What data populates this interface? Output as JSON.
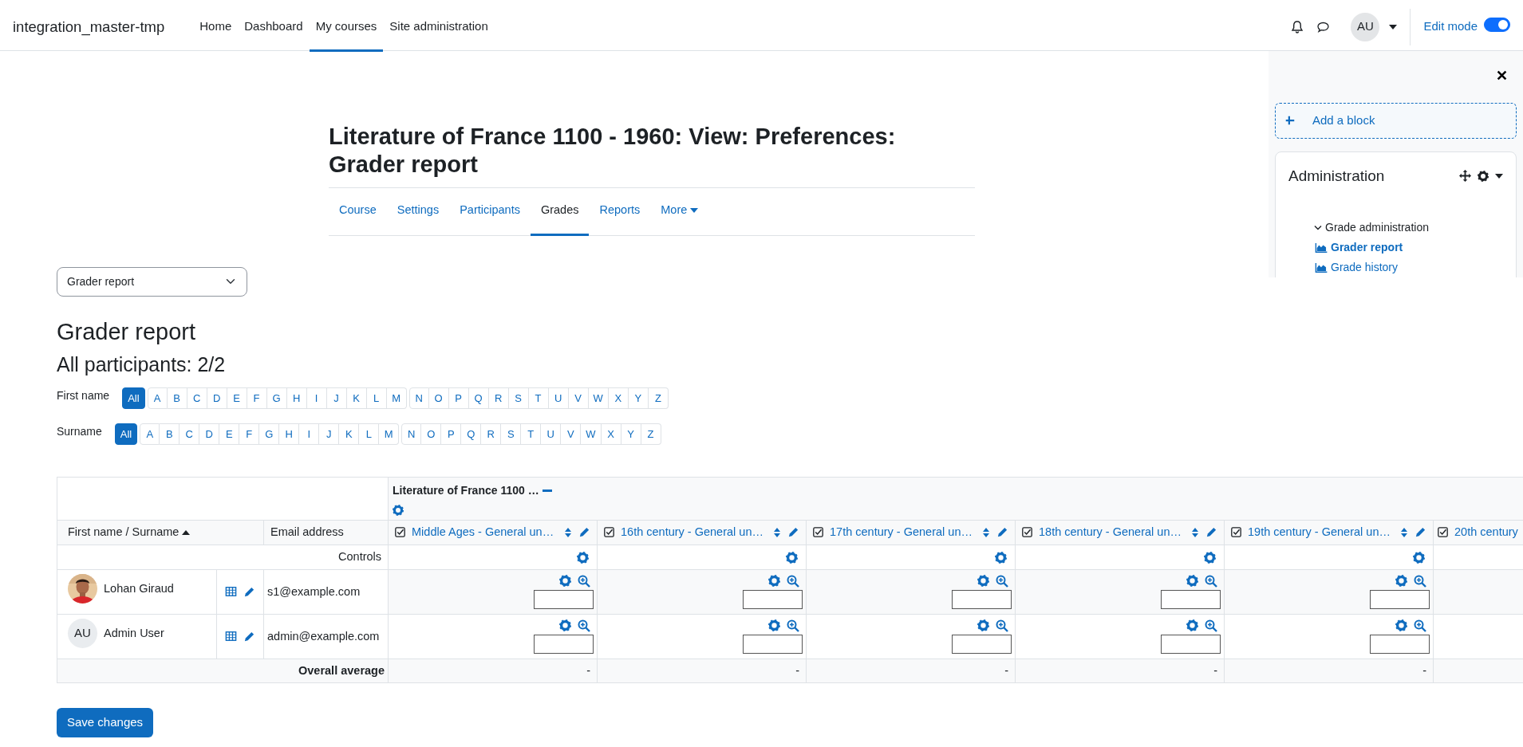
{
  "navbar": {
    "brand": "integration_master-tmp",
    "links": [
      {
        "label": "Home",
        "selected": false
      },
      {
        "label": "Dashboard",
        "selected": false
      },
      {
        "label": "My courses",
        "selected": true
      },
      {
        "label": "Site administration",
        "selected": false
      }
    ],
    "avatar": "AU",
    "edit_mode": {
      "label": "Edit mode",
      "on": true
    }
  },
  "drawer": {
    "add_block": "Add a block",
    "block_title": "Administration",
    "tree": [
      {
        "label": "Grade administration",
        "expanded": true,
        "children": [
          {
            "label": "Grader report",
            "selected": true
          },
          {
            "label": "Grade history",
            "selected": false
          }
        ]
      }
    ]
  },
  "page_title": "Literature of France 1100 - 1960: View: Preferences: Grader report",
  "course_tabs": [
    {
      "label": "Course",
      "selected": false
    },
    {
      "label": "Settings",
      "selected": false
    },
    {
      "label": "Participants",
      "selected": false
    },
    {
      "label": "Grades",
      "selected": true
    },
    {
      "label": "Reports",
      "selected": false
    },
    {
      "label": "More",
      "selected": false,
      "kind": "dropdown"
    }
  ],
  "report_select": {
    "value": "Grader report"
  },
  "heading": "Grader report",
  "subheading": "All participants: 2/2",
  "initials_bars": [
    {
      "label": "First name",
      "groups": [
        [
          {
            "label": "All",
            "selected": true
          }
        ],
        [
          {
            "label": "A",
            "selected": false
          },
          {
            "label": "B",
            "selected": false
          },
          {
            "label": "C",
            "selected": false
          },
          {
            "label": "D",
            "selected": false
          },
          {
            "label": "E",
            "selected": false
          },
          {
            "label": "F",
            "selected": false
          },
          {
            "label": "G",
            "selected": false
          },
          {
            "label": "H",
            "selected": false
          },
          {
            "label": "I",
            "selected": false
          },
          {
            "label": "J",
            "selected": false
          },
          {
            "label": "K",
            "selected": false
          },
          {
            "label": "L",
            "selected": false
          },
          {
            "label": "M",
            "selected": false
          }
        ],
        [
          {
            "label": "N",
            "selected": false
          },
          {
            "label": "O",
            "selected": false
          },
          {
            "label": "P",
            "selected": false
          },
          {
            "label": "Q",
            "selected": false
          },
          {
            "label": "R",
            "selected": false
          },
          {
            "label": "S",
            "selected": false
          },
          {
            "label": "T",
            "selected": false
          },
          {
            "label": "U",
            "selected": false
          },
          {
            "label": "V",
            "selected": false
          },
          {
            "label": "W",
            "selected": false
          },
          {
            "label": "X",
            "selected": false
          },
          {
            "label": "Y",
            "selected": false
          },
          {
            "label": "Z",
            "selected": false
          }
        ]
      ]
    },
    {
      "label": "Surname",
      "groups": [
        [
          {
            "label": "All",
            "selected": true
          }
        ],
        [
          {
            "label": "A",
            "selected": false
          },
          {
            "label": "B",
            "selected": false
          },
          {
            "label": "C",
            "selected": false
          },
          {
            "label": "D",
            "selected": false
          },
          {
            "label": "E",
            "selected": false
          },
          {
            "label": "F",
            "selected": false
          },
          {
            "label": "G",
            "selected": false
          },
          {
            "label": "H",
            "selected": false
          },
          {
            "label": "I",
            "selected": false
          },
          {
            "label": "J",
            "selected": false
          },
          {
            "label": "K",
            "selected": false
          },
          {
            "label": "L",
            "selected": false
          },
          {
            "label": "M",
            "selected": false
          }
        ],
        [
          {
            "label": "N",
            "selected": false
          },
          {
            "label": "O",
            "selected": false
          },
          {
            "label": "P",
            "selected": false
          },
          {
            "label": "Q",
            "selected": false
          },
          {
            "label": "R",
            "selected": false
          },
          {
            "label": "S",
            "selected": false
          },
          {
            "label": "T",
            "selected": false
          },
          {
            "label": "U",
            "selected": false
          },
          {
            "label": "V",
            "selected": false
          },
          {
            "label": "W",
            "selected": false
          },
          {
            "label": "X",
            "selected": false
          },
          {
            "label": "Y",
            "selected": false
          },
          {
            "label": "Z",
            "selected": false
          }
        ]
      ]
    }
  ],
  "table": {
    "category": "Literature of France 1100 …",
    "name_header": {
      "first": "First name",
      "separator": "/",
      "last": "Surname",
      "sort_ascending": true
    },
    "email_header": "Email address",
    "grade_items": [
      {
        "label": "Middle Ages - General un…",
        "cut_at_edge": false
      },
      {
        "label": "16th century - General un…",
        "cut_at_edge": false
      },
      {
        "label": "17th century - General un…",
        "cut_at_edge": false
      },
      {
        "label": "18th century - General un…",
        "cut_at_edge": false
      },
      {
        "label": "19th century - General un…",
        "cut_at_edge": false
      },
      {
        "label": "20th century",
        "cut_at_edge": true
      }
    ],
    "controls_label": "Controls",
    "students": [
      {
        "name": "Lohan Giraud",
        "email": "s1@example.com"
      },
      {
        "name": "Admin User",
        "email": "admin@example.com",
        "avatar": {
          "kind": "initials",
          "initials": "AU"
        }
      }
    ],
    "average_label": "Overall average",
    "averages": [
      "-",
      "-",
      "-",
      "-",
      "-"
    ]
  },
  "save_button": "Save changes"
}
